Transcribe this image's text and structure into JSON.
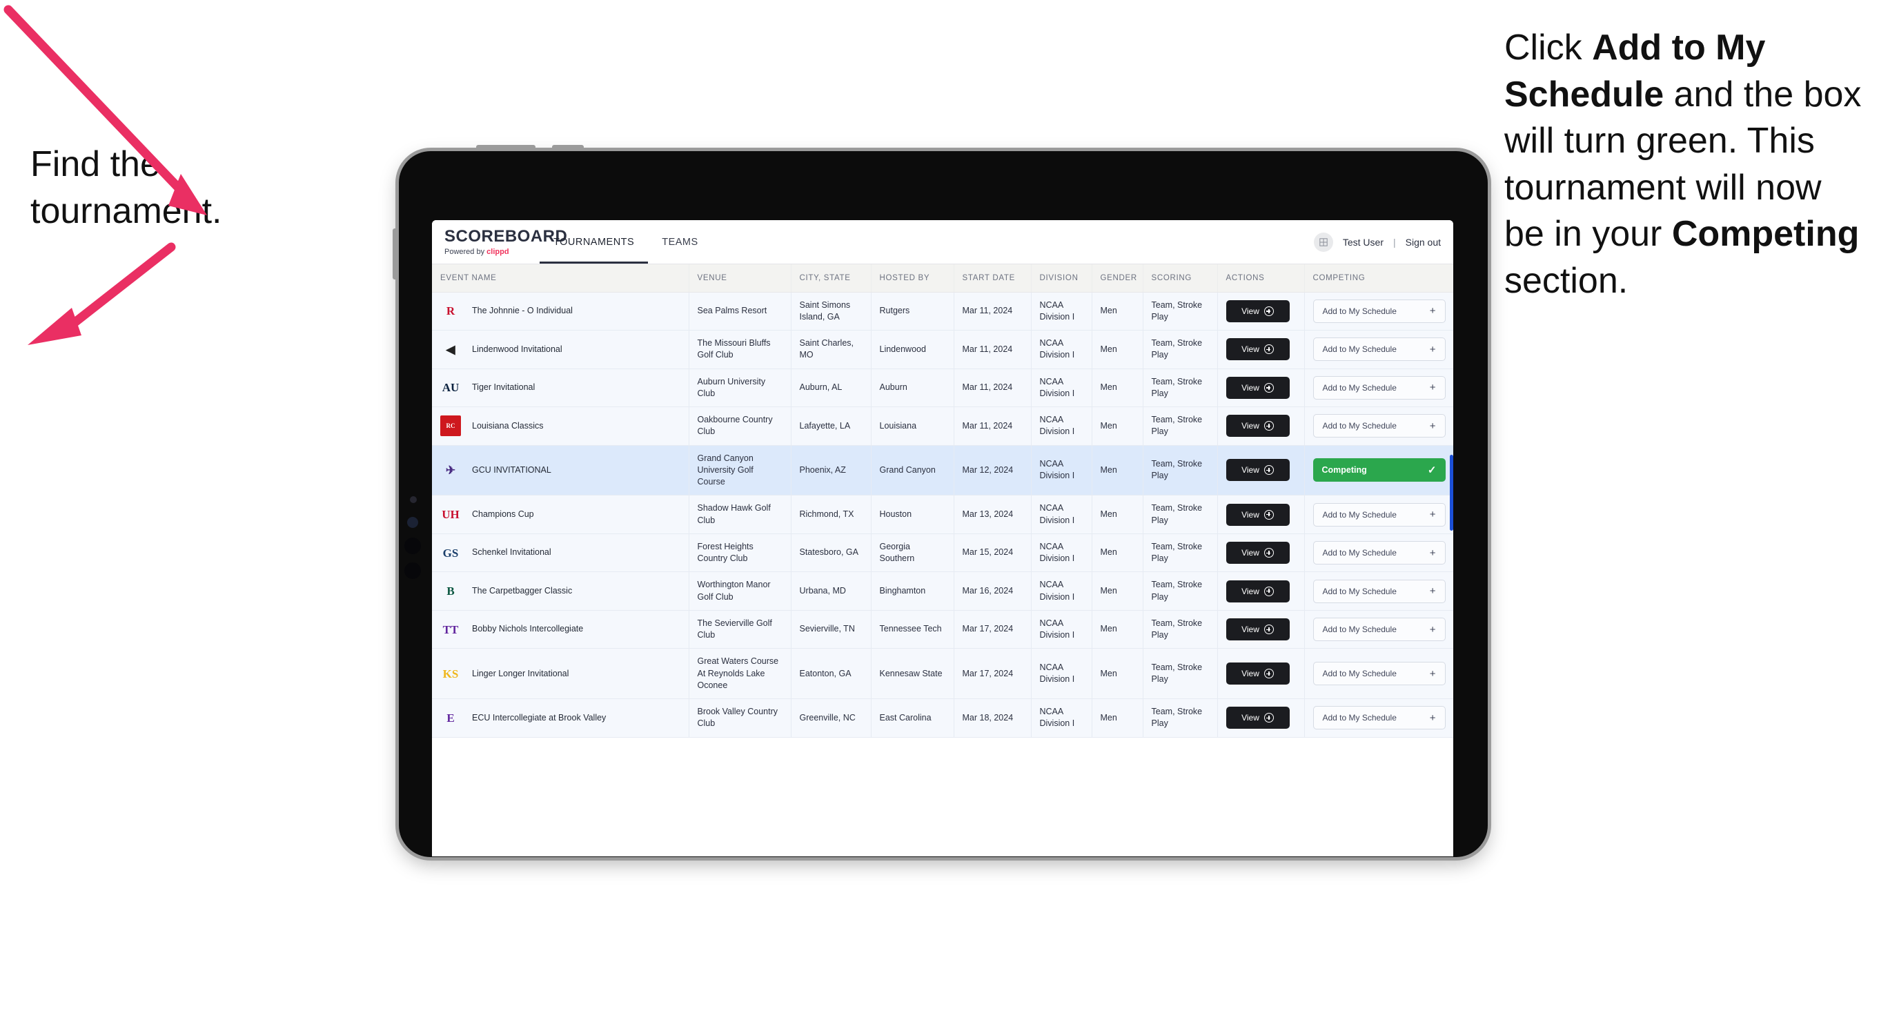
{
  "annotations": {
    "left": "Find the\ntournament.",
    "right_parts": [
      {
        "t": "Click ",
        "b": false
      },
      {
        "t": "Add to My Schedule",
        "b": true
      },
      {
        "t": " and the box will turn green. This tournament will now be in your ",
        "b": false
      },
      {
        "t": "Competing",
        "b": true
      },
      {
        "t": " section.",
        "b": false
      }
    ],
    "arrow_color": "#ea2f63"
  },
  "app": {
    "brand_title": "SCOREBOARD",
    "brand_sub_prefix": "Powered by ",
    "brand_sub_accent": "clippd",
    "tabs": [
      {
        "label": "TOURNAMENTS",
        "active": true
      },
      {
        "label": "TEAMS",
        "active": false
      }
    ],
    "account": {
      "avatar_icon": "grid-icon",
      "user": "Test User",
      "separator": "|",
      "signout": "Sign out"
    }
  },
  "table": {
    "columns": [
      "EVENT NAME",
      "VENUE",
      "CITY, STATE",
      "HOSTED BY",
      "START DATE",
      "DIVISION",
      "GENDER",
      "SCORING",
      "ACTIONS",
      "COMPETING"
    ],
    "view_label": "View",
    "add_label": "Add to My Schedule",
    "add_plus": "+",
    "competing_label": "Competing",
    "competing_check": "✓",
    "competing_color": "#2ba74d",
    "rows": [
      {
        "logo": {
          "text": "R",
          "color": "#c8102e",
          "bg": "transparent"
        },
        "event": "The Johnnie - O Individual",
        "venue": "Sea Palms Resort",
        "city": "Saint Simons Island, GA",
        "host": "Rutgers",
        "date": "Mar 11, 2024",
        "division": "NCAA Division I",
        "gender": "Men",
        "scoring": "Team, Stroke Play",
        "competing": false,
        "selected": false
      },
      {
        "logo": {
          "text": "◀",
          "color": "#222222",
          "bg": "transparent"
        },
        "event": "Lindenwood Invitational",
        "venue": "The Missouri Bluffs Golf Club",
        "city": "Saint Charles, MO",
        "host": "Lindenwood",
        "date": "Mar 11, 2024",
        "division": "NCAA Division I",
        "gender": "Men",
        "scoring": "Team, Stroke Play",
        "competing": false,
        "selected": false
      },
      {
        "logo": {
          "text": "AU",
          "color": "#0c2340",
          "bg": "transparent"
        },
        "event": "Tiger Invitational",
        "venue": "Auburn University Club",
        "city": "Auburn, AL",
        "host": "Auburn",
        "date": "Mar 11, 2024",
        "division": "NCAA Division I",
        "gender": "Men",
        "scoring": "Team, Stroke Play",
        "competing": false,
        "selected": false
      },
      {
        "logo": {
          "text": "RC",
          "color": "#ffffff",
          "bg": "#ce181e"
        },
        "event": "Louisiana Classics",
        "venue": "Oakbourne Country Club",
        "city": "Lafayette, LA",
        "host": "Louisiana",
        "date": "Mar 11, 2024",
        "division": "NCAA Division I",
        "gender": "Men",
        "scoring": "Team, Stroke Play",
        "competing": false,
        "selected": false
      },
      {
        "logo": {
          "text": "✈",
          "color": "#4b2e83",
          "bg": "transparent"
        },
        "event": "GCU INVITATIONAL",
        "venue": "Grand Canyon University Golf Course",
        "city": "Phoenix, AZ",
        "host": "Grand Canyon",
        "date": "Mar 12, 2024",
        "division": "NCAA Division I",
        "gender": "Men",
        "scoring": "Team, Stroke Play",
        "competing": true,
        "selected": true
      },
      {
        "logo": {
          "text": "UH",
          "color": "#c8102e",
          "bg": "transparent"
        },
        "event": "Champions Cup",
        "venue": "Shadow Hawk Golf Club",
        "city": "Richmond, TX",
        "host": "Houston",
        "date": "Mar 13, 2024",
        "division": "NCAA Division I",
        "gender": "Men",
        "scoring": "Team, Stroke Play",
        "competing": false,
        "selected": false
      },
      {
        "logo": {
          "text": "GS",
          "color": "#1b3f6b",
          "bg": "transparent"
        },
        "event": "Schenkel Invitational",
        "venue": "Forest Heights Country Club",
        "city": "Statesboro, GA",
        "host": "Georgia Southern",
        "date": "Mar 15, 2024",
        "division": "NCAA Division I",
        "gender": "Men",
        "scoring": "Team, Stroke Play",
        "competing": false,
        "selected": false
      },
      {
        "logo": {
          "text": "B",
          "color": "#0a5640",
          "bg": "transparent"
        },
        "event": "The Carpetbagger Classic",
        "venue": "Worthington Manor Golf Club",
        "city": "Urbana, MD",
        "host": "Binghamton",
        "date": "Mar 16, 2024",
        "division": "NCAA Division I",
        "gender": "Men",
        "scoring": "Team, Stroke Play",
        "competing": false,
        "selected": false
      },
      {
        "logo": {
          "text": "TT",
          "color": "#61259e",
          "bg": "transparent"
        },
        "event": "Bobby Nichols Intercollegiate",
        "venue": "The Sevierville Golf Club",
        "city": "Sevierville, TN",
        "host": "Tennessee Tech",
        "date": "Mar 17, 2024",
        "division": "NCAA Division I",
        "gender": "Men",
        "scoring": "Team, Stroke Play",
        "competing": false,
        "selected": false
      },
      {
        "logo": {
          "text": "KS",
          "color": "#efb71d",
          "bg": "transparent"
        },
        "event": "Linger Longer Invitational",
        "venue": "Great Waters Course At Reynolds Lake Oconee",
        "city": "Eatonton, GA",
        "host": "Kennesaw State",
        "date": "Mar 17, 2024",
        "division": "NCAA Division I",
        "gender": "Men",
        "scoring": "Team, Stroke Play",
        "competing": false,
        "selected": false
      },
      {
        "logo": {
          "text": "E",
          "color": "#61259e",
          "bg": "transparent"
        },
        "event": "ECU Intercollegiate at Brook Valley",
        "venue": "Brook Valley Country Club",
        "city": "Greenville, NC",
        "host": "East Carolina",
        "date": "Mar 18, 2024",
        "division": "NCAA Division I",
        "gender": "Men",
        "scoring": "Team, Stroke Play",
        "competing": false,
        "selected": false
      }
    ]
  }
}
